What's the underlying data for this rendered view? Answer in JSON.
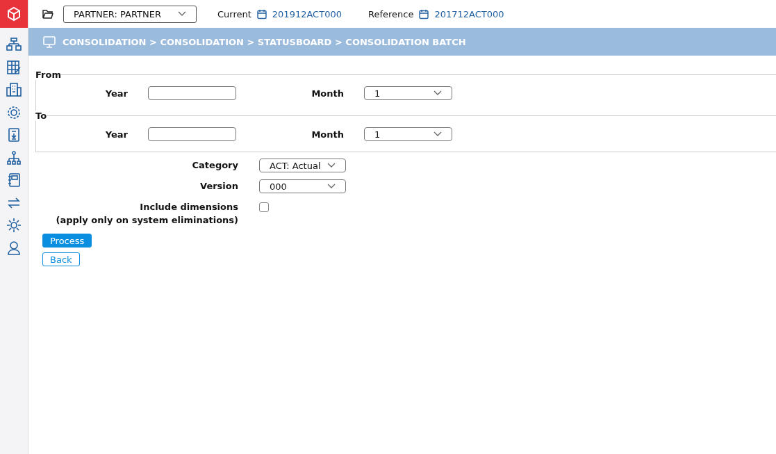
{
  "topbar": {
    "partner": "PARTNER: PARTNER",
    "current_label": "Current",
    "current_value": "201912ACT000",
    "reference_label": "Reference",
    "reference_value": "201712ACT000"
  },
  "breadcrumb": "CONSOLIDATION > CONSOLIDATION > STATUSBOARD > CONSOLIDATION BATCH",
  "ranges": [
    {
      "legend": "From",
      "year_label": "Year",
      "month_label": "Month",
      "month_value": "1"
    },
    {
      "legend": "To",
      "year_label": "Year",
      "month_label": "Month",
      "month_value": "1"
    }
  ],
  "fields": [
    {
      "kind": "select",
      "label": "Category",
      "value": "ACT: Actual"
    },
    {
      "kind": "select",
      "label": "Version",
      "value": "000"
    },
    {
      "kind": "checkbox",
      "label": "Include dimensions",
      "note": "(apply only on system eliminations)",
      "checked": false
    }
  ],
  "buttons": [
    {
      "label": "Process",
      "primary": true
    },
    {
      "label": "Back",
      "primary": false
    }
  ]
}
